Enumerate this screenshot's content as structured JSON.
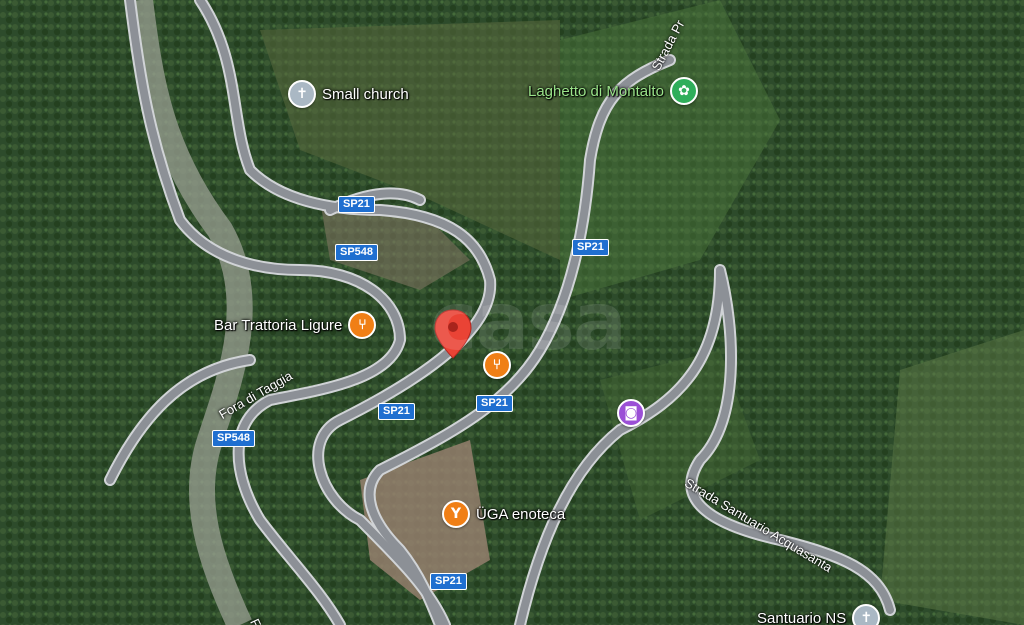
{
  "pois": [
    {
      "name": "Small church",
      "icon": "cross-icon",
      "color": "#aab8c4",
      "glyph": "✝"
    },
    {
      "name": "Laghetto di Montalto",
      "icon": "park-icon",
      "color": "#2fae5a",
      "glyph": "✿"
    },
    {
      "name": "Bar Trattoria Ligure",
      "icon": "restaurant-icon",
      "color": "#f07f16",
      "glyph": "🍴"
    },
    {
      "name": "",
      "icon": "restaurant-icon",
      "color": "#f07f16",
      "glyph": "🍴"
    },
    {
      "name": "",
      "icon": "camera-icon",
      "color": "#9b4fd6",
      "glyph": "📷"
    },
    {
      "name": "ÜGA enoteca",
      "icon": "wine-icon",
      "color": "#f07f16",
      "glyph": "🍷"
    },
    {
      "name": "Santuario NS",
      "icon": "cross-icon",
      "color": "#aab8c4",
      "glyph": "✝"
    }
  ],
  "road_shields": [
    "SP21",
    "SP548",
    "SP21",
    "SP21",
    "SP548",
    "SP21",
    "SP21"
  ],
  "road_labels": [
    "Strada Pr",
    "Fora di Taggia",
    "Strada Santuario Acquasanta",
    "Fora"
  ],
  "watermark": "casa",
  "colors": {
    "road": "#8c9096",
    "road_edge": "#cfd2d6",
    "pin": "#ea4335",
    "forest": "#2c4a2c"
  }
}
